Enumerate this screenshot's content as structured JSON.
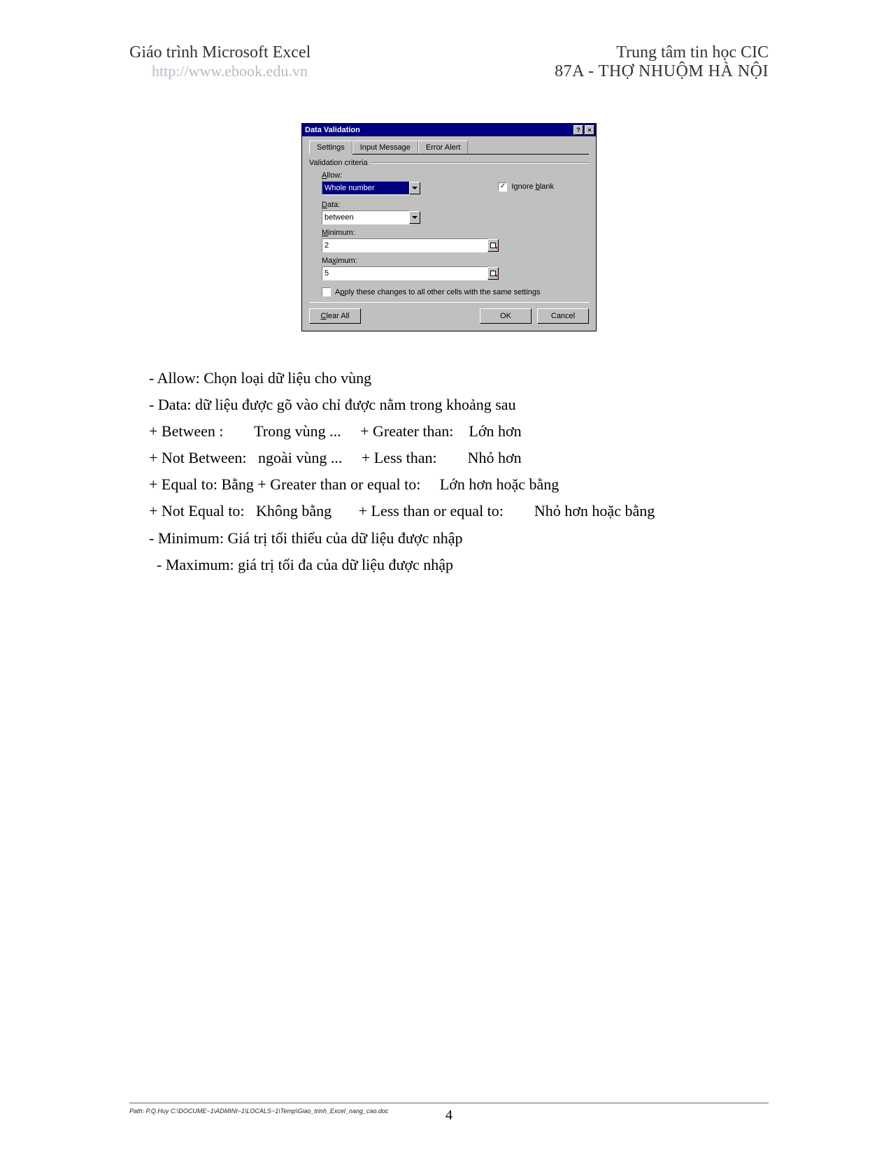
{
  "header": {
    "left_title": "Giáo trình Microsoft Excel",
    "url": "http://www.ebook.edu.vn",
    "right_line1": "Trung tâm tin học CIC",
    "right_line2": "87A - THỢ NHUỘM HÀ NỘI"
  },
  "dialog": {
    "title": "Data Validation",
    "help_btn": "?",
    "close_btn": "×",
    "tabs": [
      "Settings",
      "Input Message",
      "Error Alert"
    ],
    "group_label": "Validation criteria",
    "allow_label": "Allow:",
    "allow_value": "Whole number",
    "ignore_blank_label": "Ignore blank",
    "ignore_blank_checked": "✓",
    "data_label": "Data:",
    "data_value": "between",
    "min_label": "Minimum:",
    "min_value": "2",
    "max_label": "Maximum:",
    "max_value": "5",
    "apply_all_label": "Apply these changes to all other cells with the same settings",
    "clear_all": "Clear All",
    "ok": "OK",
    "cancel": "Cancel"
  },
  "body": {
    "l1": "- Allow: Chọn loại dữ liệu cho vùng",
    "l2": "- Data: dữ liệu được gõ vào chỉ được nằm trong khoảng sau",
    "l3": "+ Between :        Trong vùng ...     + Greater than:    Lớn hơn",
    "l4": "+ Not Between:   ngoài vùng ...     + Less than:        Nhỏ hơn",
    "l5": "+ Equal to: Bằng + Greater than or equal to:     Lớn hơn hoặc bằng",
    "l6": "+ Not Equal to:   Không bằng       + Less than or equal to:        Nhỏ hơn hoặc bằng",
    "l7": "- Minimum: Giá trị tối thiểu của dữ liệu được nhập",
    "l8": "  - Maximum: giá trị tối đa của dữ liệu được nhập"
  },
  "footer": {
    "path": "Path: P.Q.Huy C:\\DOCUME~1\\ADMINI~1\\LOCALS~1\\Temp\\Giao_trinh_Excel_nang_cao.doc",
    "page": "4"
  }
}
